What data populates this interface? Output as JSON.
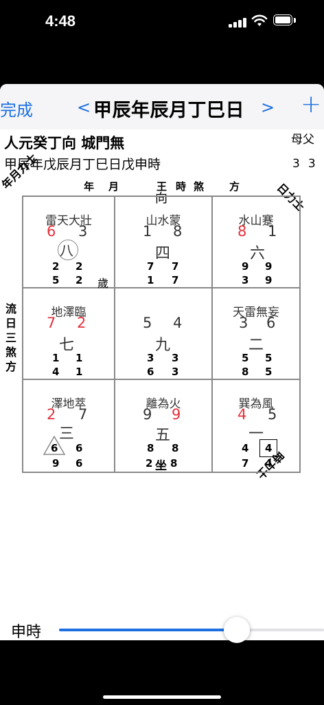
{
  "status_bar": {
    "time": "4:48"
  },
  "nav": {
    "done": "完成",
    "prev": "<",
    "title": "甲辰年辰月丁巳日",
    "next": ">",
    "add": "+"
  },
  "info": {
    "line1": "人元癸丁向 城門無",
    "line2": "甲辰年戊辰月丁巳日戊申時",
    "parents": "母父",
    "parents_values": [
      "3",
      "3"
    ]
  },
  "labels": {
    "corner_top_left": "年月力士",
    "corner_top_right": "日力士",
    "corner_bottom_right": "時力士",
    "left_vertical": [
      "流",
      "日",
      "三",
      "煞",
      "方"
    ],
    "top": [
      "年",
      "月",
      "王",
      "時",
      "煞",
      "方"
    ],
    "direction": "向",
    "year_star_mark": "歲",
    "sit_mark": "坐"
  },
  "cells": [
    {
      "title": "雷天大壯",
      "mountain": "6",
      "water": "3",
      "star": "八",
      "row1": [
        "2",
        "2"
      ],
      "row2": [
        "5",
        "2"
      ]
    },
    {
      "title": "山水蒙",
      "mountain": "1",
      "water": "8",
      "star": "四",
      "row1": [
        "7",
        "7"
      ],
      "row2": [
        "1",
        "7"
      ]
    },
    {
      "title": "水山蹇",
      "mountain": "8",
      "water": "1",
      "star": "六",
      "row1": [
        "9",
        "9"
      ],
      "row2": [
        "3",
        "9"
      ]
    },
    {
      "title": "地澤臨",
      "mountain": "7",
      "water": "2",
      "star": "七",
      "row1": [
        "1",
        "1"
      ],
      "row2": [
        "4",
        "1"
      ]
    },
    {
      "title": "",
      "mountain": "5",
      "water": "4",
      "star": "九",
      "row1": [
        "3",
        "3"
      ],
      "row2": [
        "6",
        "3"
      ]
    },
    {
      "title": "天雷無妄",
      "mountain": "3",
      "water": "6",
      "star": "二",
      "row1": [
        "5",
        "5"
      ],
      "row2": [
        "8",
        "5"
      ]
    },
    {
      "title": "澤地萃",
      "mountain": "2",
      "water": "7",
      "star": "三",
      "row1": [
        "6",
        "6"
      ],
      "row2": [
        "9",
        "6"
      ]
    },
    {
      "title": "離為火",
      "mountain": "9",
      "water": "9",
      "star": "五",
      "row1": [
        "8",
        "8"
      ],
      "row2": [
        "2",
        "8"
      ]
    },
    {
      "title": "巽為風",
      "mountain": "4",
      "water": "5",
      "star": "一",
      "row1": [
        "4",
        "4"
      ],
      "row2": [
        "7",
        "4"
      ]
    }
  ],
  "slider": {
    "label": "申時",
    "value": 0.7
  },
  "colors": {
    "accent": "#1b6fe0",
    "red": "#e5303a"
  },
  "icons": {
    "signal": "cellular-signal-icon",
    "wifi": "wifi-icon",
    "battery": "battery-icon"
  }
}
